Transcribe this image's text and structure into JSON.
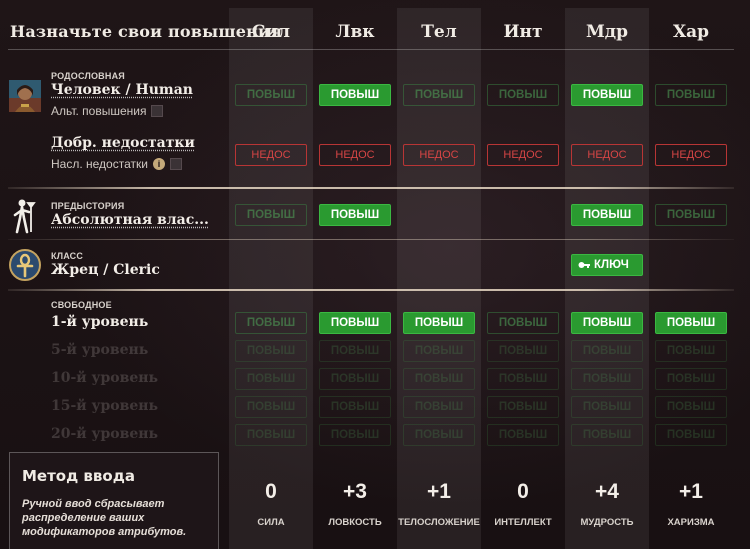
{
  "header": {
    "title": "Назначьте свои повышения"
  },
  "columns": [
    {
      "abbr": "Сил",
      "name": "СИЛА",
      "total": "0"
    },
    {
      "abbr": "Лвк",
      "name": "ЛОВКОСТЬ",
      "total": "+3"
    },
    {
      "abbr": "Тел",
      "name": "ТЕЛОСЛОЖЕНИЕ",
      "total": "+1"
    },
    {
      "abbr": "Инт",
      "name": "ИНТЕЛЛЕКТ",
      "total": "0"
    },
    {
      "abbr": "Мдр",
      "name": "МУДРОСТЬ",
      "total": "+4"
    },
    {
      "abbr": "Хар",
      "name": "ХАРИЗМА",
      "total": "+1"
    }
  ],
  "ancestry": {
    "label": "РОДОСЛОВНАЯ",
    "title": "Человек / Human",
    "alt_boosts_label": "Альт. повышения",
    "flaws_title": "Добр. недостатки",
    "inherited_flaws_label": "Насл. недостатки",
    "info_glyph": "i"
  },
  "background": {
    "label": "ПРЕДЫСТОРИЯ",
    "title": "Абсолютная влас..."
  },
  "class": {
    "label": "КЛАСС",
    "title": "Жрец / Cleric",
    "key_label": "КЛЮЧ"
  },
  "free": {
    "label": "СВОБОДНОЕ",
    "levels": [
      "1-й уровень",
      "5-й уровень",
      "10-й уровень",
      "15-й уровень",
      "20-й уровень"
    ]
  },
  "buttons": {
    "boost": "ПОВЫШ",
    "flaw": "НЕДОС"
  },
  "boost_state": {
    "ancestry": [
      "off",
      "on",
      "off",
      "off",
      "on",
      "off"
    ],
    "background": [
      "off",
      "on",
      "none",
      "none",
      "on",
      "off"
    ],
    "level_1": [
      "off",
      "on",
      "on",
      "off",
      "on",
      "on"
    ]
  },
  "method": {
    "title": "Метод ввода",
    "description": "Ручной ввод сбрасывает распределение ваших модификаторов атрибутов."
  },
  "colors": {
    "active": "#2a9a30",
    "flaw": "#d64545",
    "background": "#1c1214"
  }
}
